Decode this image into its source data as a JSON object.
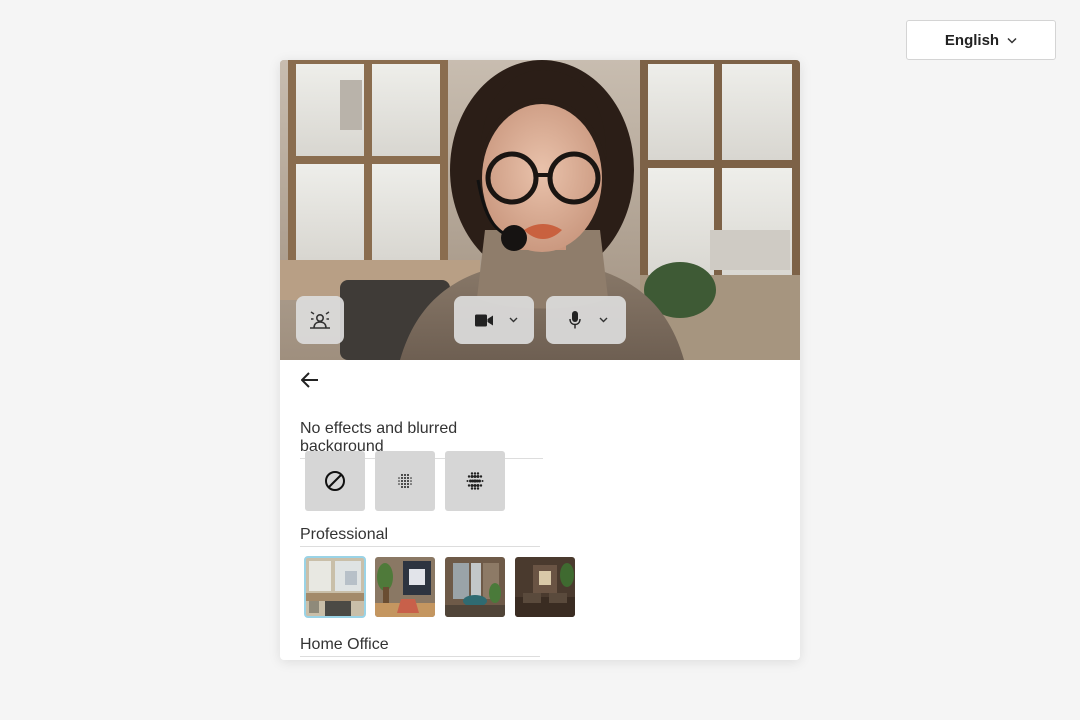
{
  "language": {
    "selected": "English"
  },
  "preview": {
    "controls": {
      "effects": "effects-icon",
      "camera": "camera-icon",
      "mic": "microphone-icon"
    }
  },
  "sections": [
    {
      "title": "No effects and blurred background",
      "options": [
        {
          "icon": "no-effect-icon"
        },
        {
          "icon": "slight-blur-icon"
        },
        {
          "icon": "strong-blur-icon"
        }
      ]
    },
    {
      "title": "Professional",
      "options": [
        {
          "icon": "office-window-background",
          "selected": true
        },
        {
          "icon": "office-plant-background"
        },
        {
          "icon": "office-corridor-background"
        },
        {
          "icon": "office-lobby-background"
        }
      ]
    },
    {
      "title": "Home Office"
    }
  ],
  "colors": {
    "selected_outline": "#9ad3e6",
    "tile_grey": "#d6d6d6"
  }
}
